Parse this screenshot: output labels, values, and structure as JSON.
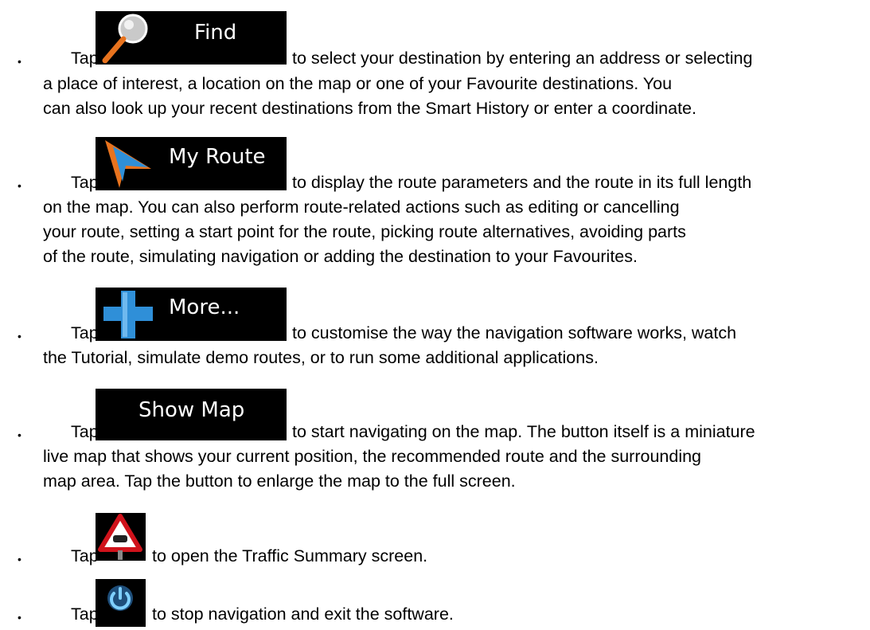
{
  "items": [
    {
      "tap": "Tap",
      "button": {
        "label": "Find",
        "icon": "magnifier-icon"
      },
      "lines": [
        "to select your destination by entering an address or selecting",
        "a place of interest, a location on the map or one of your Favourite destinations. You",
        "can also look up your recent destinations from the Smart History or enter a coordinate."
      ]
    },
    {
      "tap": "Tap",
      "button": {
        "label": "My Route",
        "icon": "route-arrow-icon"
      },
      "lines": [
        "to display the route parameters and the route in its full length",
        "on the map. You can also perform route-related actions such as editing or cancelling",
        "your route, setting a start point for the route, picking route alternatives, avoiding parts",
        "of the route, simulating navigation or adding the destination to your Favourites."
      ]
    },
    {
      "tap": "Tap",
      "button": {
        "label": "More...",
        "icon": "plus-icon"
      },
      "lines": [
        "to customise the way the navigation software works, watch",
        "the Tutorial, simulate demo routes, or to run some additional applications."
      ]
    },
    {
      "tap": "Tap",
      "button": {
        "label": "Show Map"
      },
      "lines": [
        "to start navigating on the map. The button itself is a miniature",
        "live map that shows your current position, the recommended route and the surrounding",
        "map area. Tap the button to enlarge the map to the full screen."
      ]
    },
    {
      "tap": "Tap",
      "button": {
        "icon": "traffic-warning-icon"
      },
      "lines": [
        "to open the Traffic Summary screen."
      ]
    },
    {
      "tap": "Tap",
      "button": {
        "icon": "power-icon"
      },
      "lines": [
        "to stop navigation and exit the software."
      ]
    }
  ],
  "bullet_symbol": "•",
  "colors": {
    "button_bg": "#000000",
    "button_text": "#ffffff",
    "accent_blue": "#2f8fd8",
    "accent_orange": "#e8731e"
  }
}
